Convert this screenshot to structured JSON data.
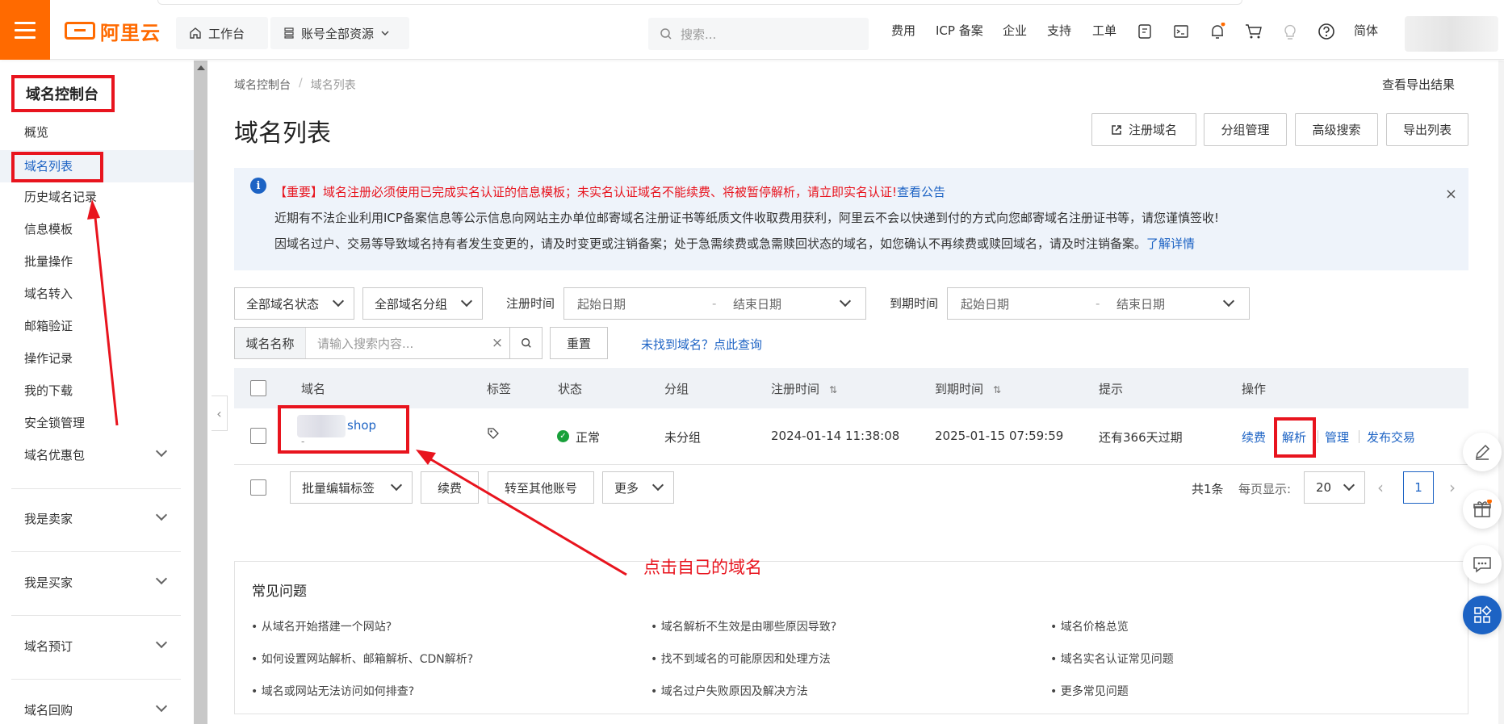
{
  "topbar": {
    "logo_text": "阿里云",
    "workbench": "工作台",
    "resource": "账号全部资源",
    "search_placeholder": "搜索...",
    "nav": [
      "费用",
      "ICP 备案",
      "企业",
      "支持",
      "工单"
    ],
    "lang": "简体"
  },
  "sidebar": {
    "title": "域名控制台",
    "items": [
      "概览",
      "域名列表",
      "历史域名记录",
      "信息模板",
      "批量操作",
      "域名转入",
      "邮箱验证",
      "操作记录",
      "我的下载",
      "安全锁管理"
    ],
    "groups": [
      "域名优惠包",
      "我是卖家",
      "我是买家",
      "域名预订",
      "域名回购"
    ]
  },
  "breadcrumb": [
    "域名控制台",
    "域名列表"
  ],
  "export_result": "查看导出结果",
  "page_title": "域名列表",
  "header_buttons": [
    "注册域名",
    "分组管理",
    "高级搜索",
    "导出列表"
  ],
  "notice": {
    "line1": "【重要】域名注册必须使用已完成实名认证的信息模板；未实名认证域名不能续费、将被暂停解析，请立即实名认证!",
    "line1_link": "查看公告",
    "line2": "近期有不法企业利用ICP备案信息等公示信息向网站主办单位邮寄域名注册证书等纸质文件收取费用获利，阿里云不会以快递到付的方式向您邮寄域名注册证书等，请您谨慎签收!",
    "line3": "因域名过户、交易等导致域名持有者发生变更的，请及时变更或注销备案；处于急需续费或急需赎回状态的域名，如您确认不再续费或赎回域名，请及时注销备案。",
    "line3_link": "了解详情",
    "close": "×"
  },
  "filters": {
    "status": "全部域名状态",
    "group": "全部域名分组",
    "reg_label": "注册时间",
    "exp_label": "到期时间",
    "start_date": "起始日期",
    "end_date": "结束日期",
    "dash": "-",
    "search_label": "域名名称",
    "search_placeholder": "请输入搜索内容...",
    "reset": "重置",
    "not_found": "未找到域名？点此查询"
  },
  "table": {
    "headers": [
      "域名",
      "标签",
      "状态",
      "分组",
      "注册时间",
      "到期时间",
      "提示",
      "操作"
    ],
    "row": {
      "domain": "shop",
      "domain_sub": "-",
      "status": "正常",
      "group": "未分组",
      "reg_time": "2024-01-14 11:38:08",
      "exp_time": "2025-01-15 07:59:59",
      "hint": "还有366天过期",
      "ops": [
        "续费",
        "解析",
        "管理",
        "发布交易"
      ]
    }
  },
  "bulk": {
    "edit_tags": "批量编辑标签",
    "renew": "续费",
    "transfer": "转至其他账号",
    "more": "更多",
    "total": "共1条",
    "per_page_label": "每页显示:",
    "per_page": "20",
    "page": "1"
  },
  "faq": {
    "title": "常见问题",
    "questions": [
      "• 从域名开始搭建一个网站?",
      "• 域名解析不生效是由哪些原因导致?",
      "• 域名价格总览",
      "• 如何设置网站解析、邮箱解析、CDN解析?",
      "• 找不到域名的可能原因和处理方法",
      "• 域名实名认证常见问题",
      "• 域名或网站无法访问如何排查?",
      "• 域名过户失败原因及解决方法",
      "• 更多常见问题"
    ]
  },
  "annotation": "点击自己的域名",
  "colors": {
    "accent": "#ff6a00",
    "link": "#1d63c4",
    "annotation": "#e8141e",
    "ok": "#18a03a"
  }
}
